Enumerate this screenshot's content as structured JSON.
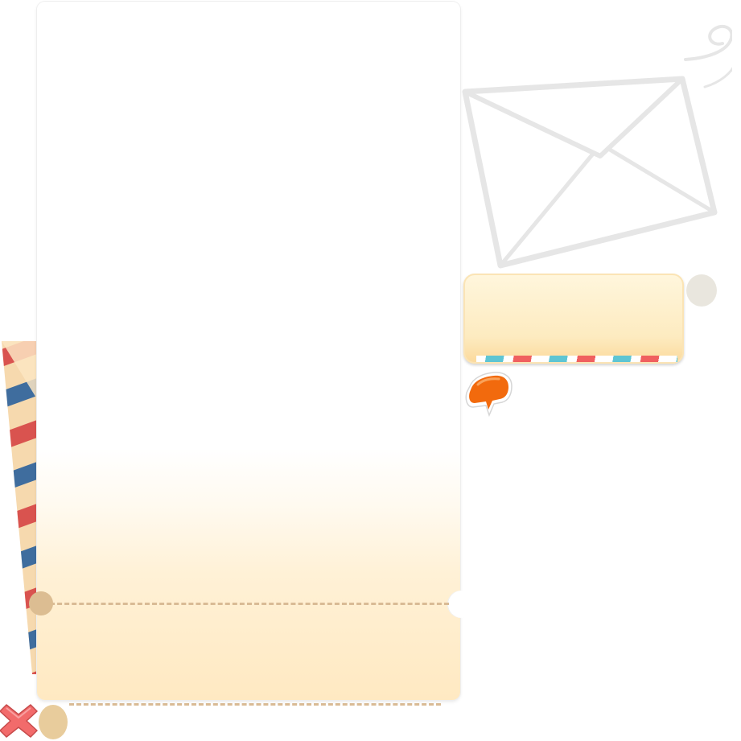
{
  "letter": {
    "body_text": ""
  },
  "info_card": {
    "text": "",
    "stripe_colors": [
      "#5ec5d3",
      "#f0605f"
    ]
  },
  "airmail_strip": {
    "stripe_colors": [
      "#d9534f",
      "#3f6d9e",
      "#f6d9ae"
    ]
  },
  "icons": {
    "envelope": "envelope-icon",
    "speech_bubble": "speech-bubble-icon",
    "close": "close-icon"
  },
  "colors": {
    "card_bottom": "#ffe9c2",
    "perforation": "#d9bb95",
    "bubble_orange": "#f26a0d",
    "close_red": "#f26b6b"
  }
}
